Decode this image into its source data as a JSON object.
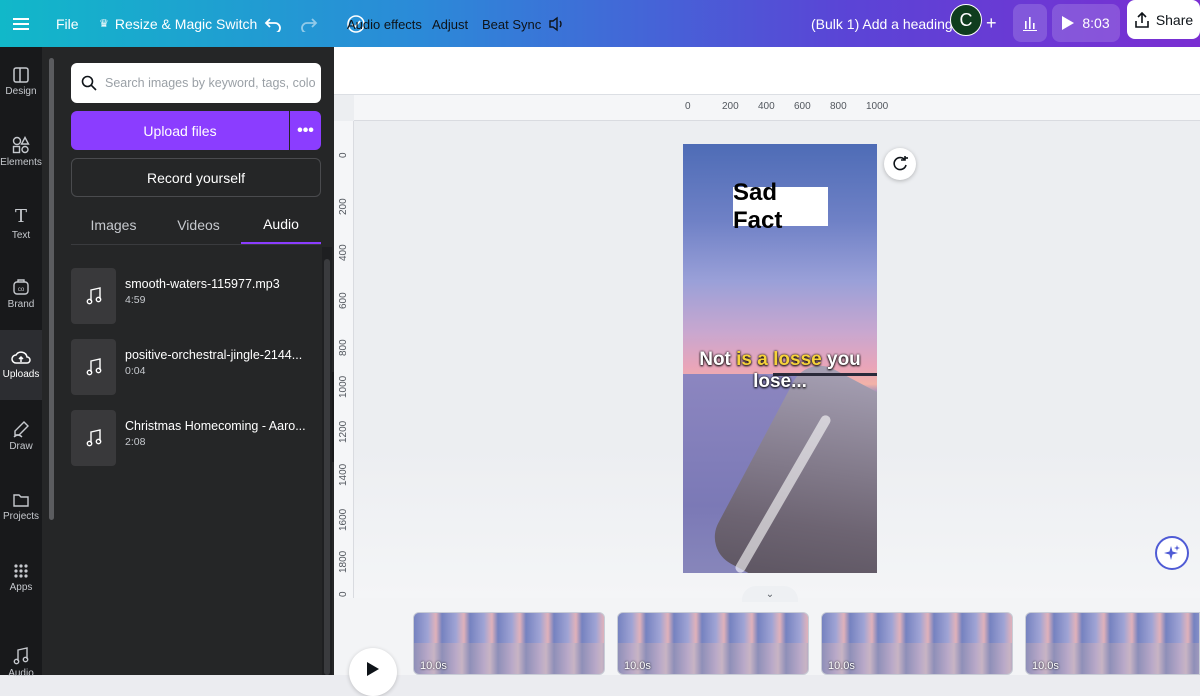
{
  "topbar": {
    "file": "File",
    "resize": "Resize & Magic Switch",
    "doc_title": "(Bulk 1) Add a heading",
    "avatar_initial": "C",
    "play_time": "8:03",
    "share": "Share"
  },
  "rail": [
    {
      "label": "Design",
      "icon": "design-icon"
    },
    {
      "label": "Elements",
      "icon": "elements-icon"
    },
    {
      "label": "Text",
      "icon": "text-icon"
    },
    {
      "label": "Brand",
      "icon": "brand-icon"
    },
    {
      "label": "Uploads",
      "icon": "uploads-icon"
    },
    {
      "label": "Draw",
      "icon": "draw-icon"
    },
    {
      "label": "Projects",
      "icon": "projects-icon"
    },
    {
      "label": "Apps",
      "icon": "apps-icon"
    },
    {
      "label": "Audio",
      "icon": "audio-icon"
    }
  ],
  "panel": {
    "search_placeholder": "Search images by keyword, tags, colour",
    "upload": "Upload files",
    "record": "Record yourself",
    "tabs": [
      "Images",
      "Videos",
      "Audio"
    ],
    "active_tab": "Audio",
    "audio": [
      {
        "name": "smooth-waters-115977.mp3",
        "duration": "4:59"
      },
      {
        "name": "positive-orchestral-jingle-2144...",
        "duration": "0:04"
      },
      {
        "name": "Christmas Homecoming - Aaro...",
        "duration": "2:08"
      }
    ]
  },
  "context_bar": {
    "audio_effects": "Audio effects",
    "adjust": "Adjust",
    "beat_sync": "Beat Sync"
  },
  "ruler": {
    "h": [
      "0",
      "200",
      "400",
      "600",
      "800",
      "1000"
    ],
    "v": [
      "0",
      "200",
      "400",
      "600",
      "800",
      "1000",
      "1200",
      "1400",
      "1600",
      "1800",
      "0"
    ]
  },
  "page": {
    "heading": "Sad Fact",
    "caption_a": "Not ",
    "caption_hl": "is a losse",
    "caption_b": " you",
    "caption_line2": "lose..."
  },
  "timeline": {
    "clips": [
      "10.0s",
      "10.0s",
      "10.0s",
      "10.0s"
    ]
  },
  "colors": {
    "accent": "#8b3dff",
    "panel_bg": "#252627",
    "rail_bg": "#18191b"
  }
}
